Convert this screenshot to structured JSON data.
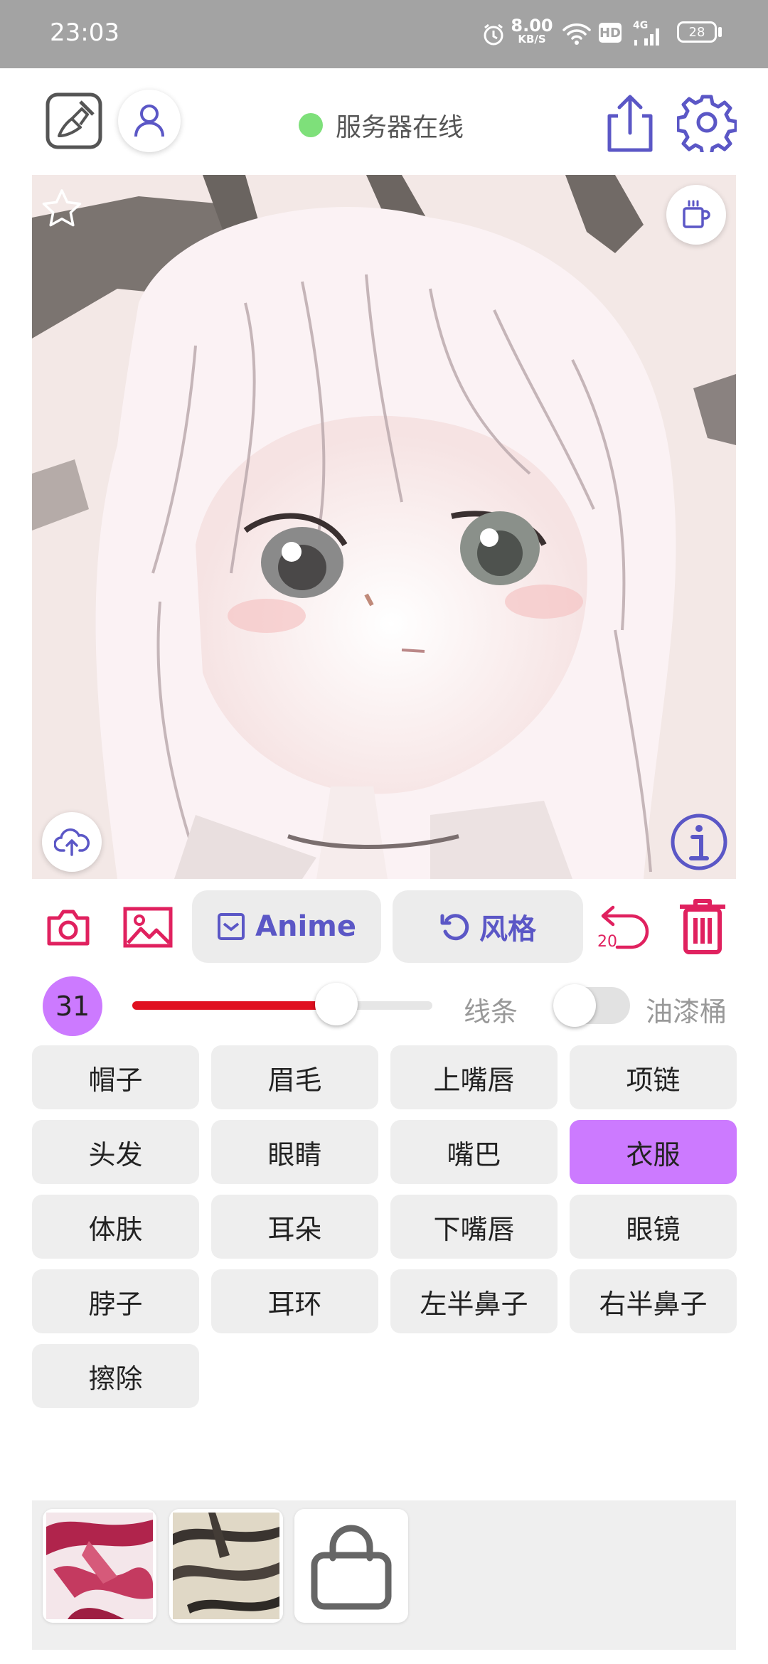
{
  "status_bar": {
    "time": "23:03",
    "net_speed_value": "8.00",
    "net_speed_unit": "KB/S",
    "hd_badge": "HD",
    "signal_label": "4G",
    "battery": "28",
    "icons": [
      "alarm-icon",
      "wifi-icon",
      "hd-icon",
      "signal-icon",
      "battery-icon"
    ]
  },
  "toolbar": {
    "server_status": "服务器在线",
    "server_status_color": "#7ee07a",
    "icons": [
      "edit-icon",
      "user-icon",
      "share-icon",
      "gear-icon"
    ],
    "accent": "#5b57c6"
  },
  "canvas": {
    "icons": [
      "star-icon",
      "coffee-icon",
      "cloud-upload-icon",
      "info-icon"
    ]
  },
  "tools": {
    "model_label": "Anime",
    "style_label": "风格",
    "undo_count": "20",
    "icons": [
      "camera-icon",
      "image-icon",
      "checkbox-icon",
      "refresh-icon",
      "undo-icon",
      "trash-icon"
    ],
    "danger_color": "#e0215f"
  },
  "brush": {
    "size": "31",
    "slider_level": 0.68,
    "line_label": "线条",
    "bucket_label": "油漆桶",
    "bucket_enabled": false
  },
  "labels": {
    "items": [
      "帽子",
      "眉毛",
      "上嘴唇",
      "项链",
      "头发",
      "眼睛",
      "嘴巴",
      "衣服",
      "体肤",
      "耳朵",
      "下嘴唇",
      "眼镜",
      "脖子",
      "耳环",
      "左半鼻子",
      "右半鼻子",
      "擦除"
    ],
    "selected": "衣服",
    "selected_color": "#cc7aff"
  },
  "tray": {
    "icons": [
      "red-texture-thumbnail",
      "zebra-texture-thumbnail",
      "shop-bag-icon"
    ]
  }
}
